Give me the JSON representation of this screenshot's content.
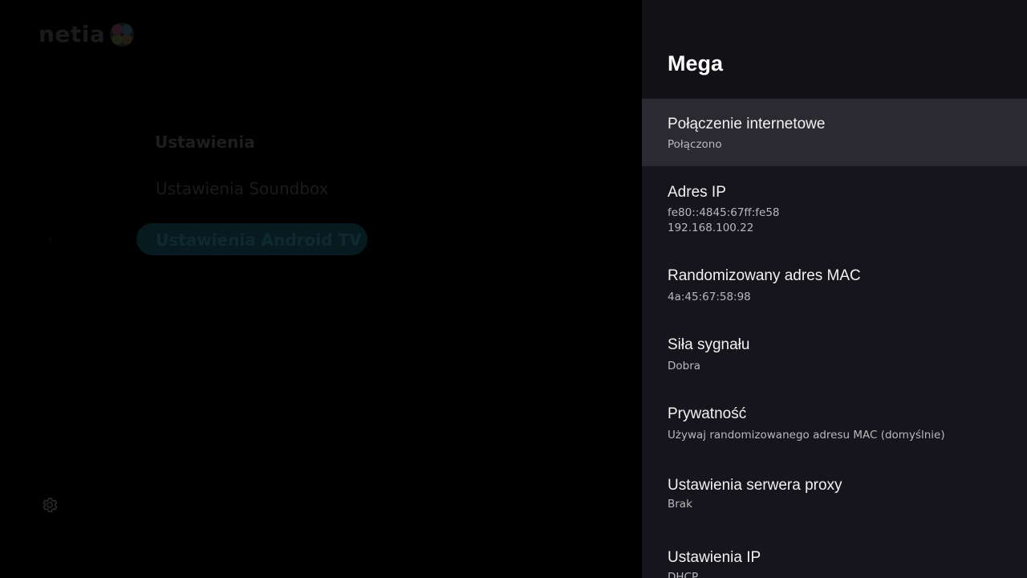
{
  "background": {
    "logo_text": "netia",
    "menu": [
      {
        "label": "Ustawienia"
      },
      {
        "label": "Ustawienia Soundbox"
      },
      {
        "label": "Ustawienia Android TV"
      }
    ]
  },
  "panel": {
    "title": "Mega",
    "items": [
      {
        "title": "Połączenie internetowe",
        "subtitle": "Połączono"
      },
      {
        "title": "Adres IP",
        "subtitle": "fe80::4845:67ff:fe58",
        "subtitle2": "192.168.100.22"
      },
      {
        "title": "Randomizowany adres MAC",
        "subtitle": "4a:45:67:58:98"
      },
      {
        "title": "Siła sygnału",
        "subtitle": "Dobra"
      },
      {
        "title": "Prywatność",
        "subtitle": "Używaj randomizowanego adresu MAC (domyślnie)"
      },
      {
        "title": "Ustawienia serwera proxy",
        "subtitle": "Brak"
      },
      {
        "title": "Ustawienia IP",
        "subtitle": "DHCP"
      }
    ]
  },
  "colors": {
    "panel_bg": "#16151b",
    "focused_item_bg": "#2b2a31",
    "text_primary": "#f2f2f2",
    "text_secondary": "#b8b8bd"
  }
}
